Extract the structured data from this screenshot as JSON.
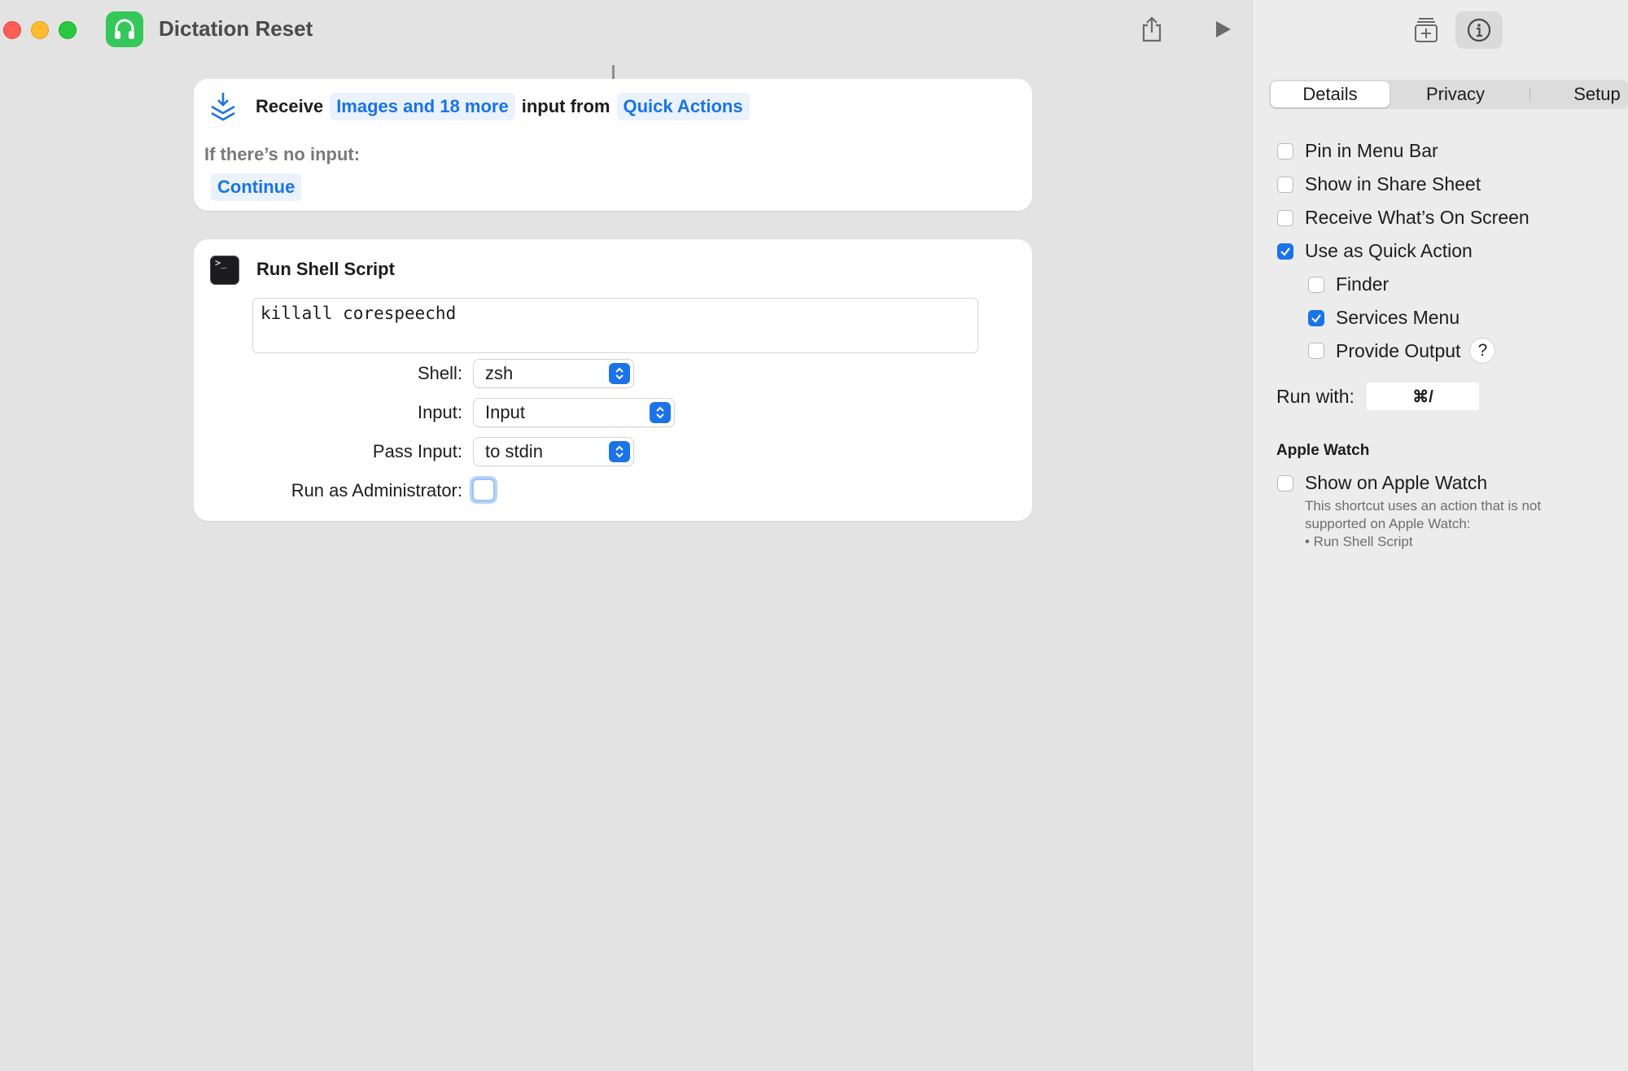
{
  "window": {
    "title": "Dictation Reset"
  },
  "receive_card": {
    "receive_label": "Receive",
    "input_types_token": "Images and 18 more",
    "input_from_label": "input from",
    "source_token": "Quick Actions",
    "no_input_label": "If there’s no input:",
    "no_input_action": "Continue"
  },
  "shell_card": {
    "title": "Run Shell Script",
    "script": "killall corespeechd",
    "shell_label": "Shell:",
    "shell_value": "zsh",
    "input_label": "Input:",
    "input_value": "Input",
    "pass_input_label": "Pass Input:",
    "pass_input_value": "to stdin",
    "admin_label": "Run as Administrator:",
    "admin_checked": false
  },
  "inspector": {
    "tabs": [
      {
        "label": "Details",
        "active": true
      },
      {
        "label": "Privacy",
        "active": false
      },
      {
        "label": "Setup",
        "active": false
      }
    ],
    "options": [
      {
        "label": "Pin in Menu Bar",
        "checked": false
      },
      {
        "label": "Show in Share Sheet",
        "checked": false
      },
      {
        "label": "Receive What’s On Screen",
        "checked": false
      },
      {
        "label": "Use as Quick Action",
        "checked": true
      }
    ],
    "sub_options": [
      {
        "label": "Finder",
        "checked": false
      },
      {
        "label": "Services Menu",
        "checked": true
      },
      {
        "label": "Provide Output",
        "checked": false
      }
    ],
    "help_label": "?",
    "run_with_label": "Run with:",
    "run_with_value": "⌘/",
    "apple_watch": {
      "section_title": "Apple Watch",
      "option_label": "Show on Apple Watch",
      "option_checked": false,
      "note_line1": "This shortcut uses an action that is not",
      "note_line2": "supported on Apple Watch:",
      "note_line3": "• Run Shell Script"
    }
  },
  "colors": {
    "accent": "#1a73e8",
    "app_icon": "#34c759"
  }
}
